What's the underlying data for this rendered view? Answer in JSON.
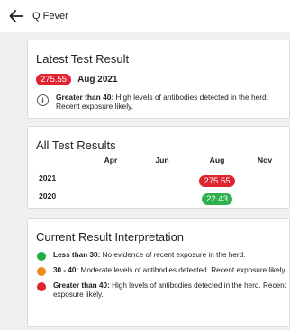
{
  "header": {
    "title": "Q Fever",
    "back_icon": "arrow-left-icon"
  },
  "latest": {
    "title": "Latest Test Result",
    "value": "275.55",
    "value_color": "#e0242f",
    "date": "Aug 2021",
    "info_icon": "info-icon",
    "note_bold": "Greater than 40:",
    "note_text": " High levels of antibodies detected in the herd. Recent exposure likely."
  },
  "all_results": {
    "title": "All Test Results",
    "columns": [
      "Apr",
      "Jun",
      "Aug",
      "Nov"
    ],
    "rows": [
      {
        "year": "2021",
        "aug": "275.55",
        "aug_color": "#e0242f"
      },
      {
        "year": "2020",
        "aug": "22.43",
        "aug_color": "#2fb14f"
      }
    ]
  },
  "interpretation": {
    "title": "Current Result Interpretation",
    "items": [
      {
        "color": "#1fae3f",
        "bold": "Less than 30:",
        "text": " No evidence of recent exposure in the herd."
      },
      {
        "color": "#f08a1c",
        "bold": "30 - 40:",
        "text": " Moderate levels of antibodies detected. Recent exposure likely."
      },
      {
        "color": "#e0242f",
        "bold": "Greater than 40:",
        "text": " High levels of antibodies detected in the herd. Recent exposure likely."
      }
    ]
  }
}
